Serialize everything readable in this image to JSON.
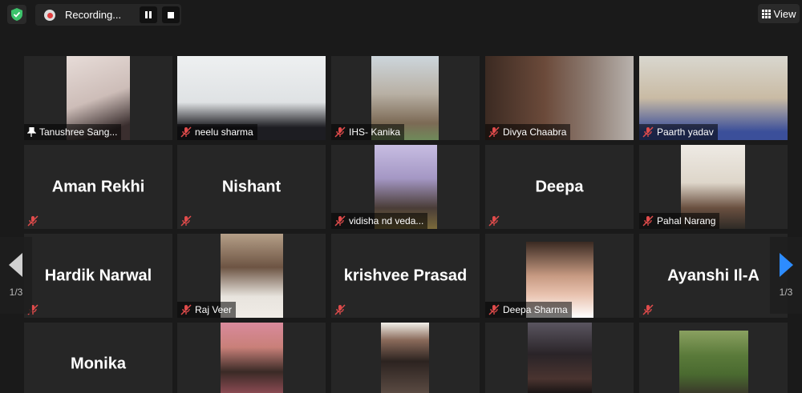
{
  "toolbar": {
    "recording_label": "Recording...",
    "view_label": "View"
  },
  "pager": {
    "left_label": "1/3",
    "right_label": "1/3"
  },
  "participants": [
    {
      "name": "Tanushree Sang...",
      "big": ""
    },
    {
      "name": "neelu sharma",
      "big": ""
    },
    {
      "name": "IHS- Kanika",
      "big": ""
    },
    {
      "name": "Divya Chaabra",
      "big": ""
    },
    {
      "name": "Paarth yadav",
      "big": ""
    },
    {
      "name": "",
      "big": "Aman Rekhi"
    },
    {
      "name": "",
      "big": "Nishant"
    },
    {
      "name": "vidisha nd veda...",
      "big": ""
    },
    {
      "name": "",
      "big": "Deepa"
    },
    {
      "name": "Pahal Narang",
      "big": ""
    },
    {
      "name": "",
      "big": "Hardik Narwal"
    },
    {
      "name": "Raj Veer",
      "big": ""
    },
    {
      "name": "",
      "big": "krishvee Prasad"
    },
    {
      "name": "Deepa Sharma",
      "big": ""
    },
    {
      "name": "",
      "big": "Ayanshi Il-A"
    },
    {
      "name": "",
      "big": "Monika"
    }
  ],
  "colors": {
    "background": "#1a1a1a",
    "tile": "#262626",
    "shield": "#3cc36b",
    "recording_dot": "#e03e3e",
    "mute": "#e04b4b",
    "nav_arrow": "#2d8cff"
  }
}
